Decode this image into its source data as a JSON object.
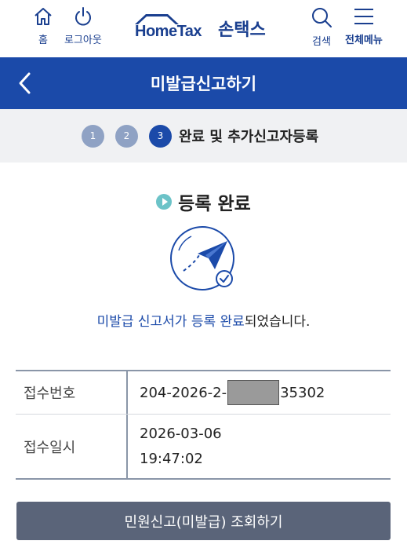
{
  "header": {
    "home_label": "홈",
    "logout_label": "로그아웃",
    "brand_name": "HomeTax",
    "brand_sub": "손택스",
    "search_label": "검색",
    "menu_label": "전체메뉴",
    "icons": {
      "home": "home-icon",
      "logout": "power-icon",
      "search": "search-icon",
      "menu": "hamburger-icon",
      "back": "chevron-left-icon"
    }
  },
  "title_bar": {
    "title": "미발급신고하기"
  },
  "steps": {
    "items": [
      {
        "number": "1",
        "state": "inactive"
      },
      {
        "number": "2",
        "state": "inactive"
      },
      {
        "number": "3",
        "state": "active"
      }
    ],
    "current_label": "완료 및 추가신고자등록"
  },
  "section": {
    "heading": "등록 완료"
  },
  "message": {
    "highlight_1": "미발급 신고서가",
    "mid": " ",
    "highlight_2": "등록 완료",
    "rest": "되었습니다."
  },
  "info": {
    "receipt_no_label": "접수번호",
    "receipt_no_prefix": "204-2026-2-",
    "receipt_no_suffix": "35302",
    "receipt_dt_label": "접수일시",
    "receipt_date": "2026-03-06",
    "receipt_time": "19:47:02"
  },
  "actions": {
    "inquiry_button": "민원신고(미발급) 조회하기"
  },
  "colors": {
    "primary": "#1b4aa9",
    "step_inactive": "#8fa2c4",
    "step_bg": "#f0f1f3",
    "button": "#5a6479",
    "accent_play": "#6cc3c8"
  }
}
